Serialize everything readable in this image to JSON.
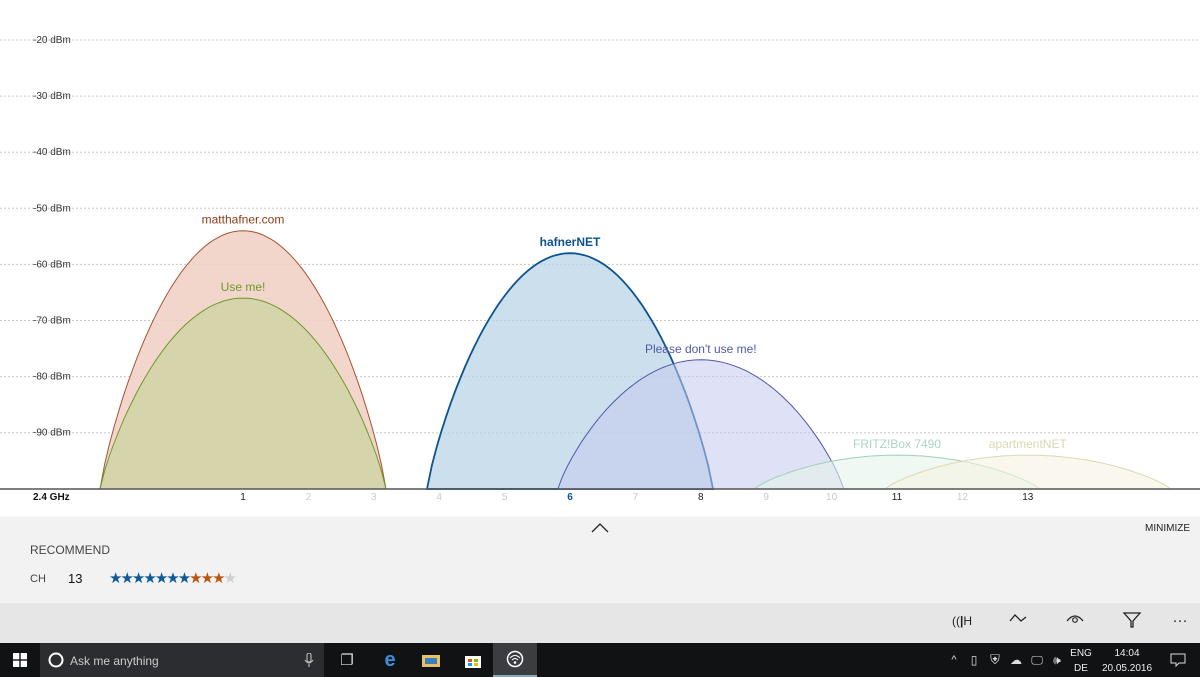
{
  "chart_data": {
    "type": "area",
    "band_label": "2.4 GHz",
    "y_ticks": [
      "-20 dBm",
      "-30 dBm",
      "-40 dBm",
      "-50 dBm",
      "-60 dBm",
      "-70 dBm",
      "-80 dBm",
      "-90 dBm"
    ],
    "y_values": [
      -20,
      -30,
      -40,
      -50,
      -60,
      -70,
      -80,
      -90
    ],
    "ylim": [
      -100,
      -13
    ],
    "channels": [
      "1",
      "2",
      "3",
      "4",
      "5",
      "6",
      "7",
      "8",
      "9",
      "10",
      "11",
      "12",
      "13"
    ],
    "active_channels": [
      1,
      6,
      8,
      11,
      13
    ],
    "highlight_channel": 6,
    "networks": [
      {
        "name": "matthafner.com",
        "channel": 1,
        "signal": -54,
        "stroke": "#a5532f",
        "fill": "#f0cfc3",
        "fill_opacity": 0.85,
        "label_color": "#8a3d1a",
        "bold": false
      },
      {
        "name": "Use me!",
        "channel": 1,
        "signal": -66,
        "stroke": "#6e9a2c",
        "fill": "#cdd3a2",
        "fill_opacity": 0.8,
        "label_color": "#6e9a2c",
        "bold": false
      },
      {
        "name": "hafnerNET",
        "channel": 6,
        "signal": -58,
        "stroke": "#0b5391",
        "fill": "#b6d2e6",
        "fill_opacity": 0.7,
        "label_color": "#0b5391",
        "bold": true
      },
      {
        "name": "Please don't use me!",
        "channel": 8,
        "signal": -77,
        "stroke": "#4f5aa5",
        "fill": "#c4cbef",
        "fill_opacity": 0.55,
        "label_color": "#4f5aa5",
        "bold": false
      },
      {
        "name": "FRITZ!Box 7490",
        "channel": 11,
        "signal": -94,
        "stroke": "#9fd0b8",
        "fill": "#e4f4ea",
        "fill_opacity": 0.6,
        "label_color": "#a9d6bf",
        "bold": false
      },
      {
        "name": "apartmentNET",
        "channel": 13,
        "signal": -94,
        "stroke": "#ddd8b0",
        "fill": "#f6f4e2",
        "fill_opacity": 0.6,
        "label_color": "#ddd6b0",
        "bold": false
      }
    ]
  },
  "panel": {
    "recommend_label": "RECOMMEND",
    "ch_label": "CH",
    "ch_value": "13",
    "rating": {
      "blue": 7,
      "orange": 3,
      "gray": 1,
      "total": 11
    },
    "minimize_label": "MINIMIZE"
  },
  "appbar": {
    "more": "···"
  },
  "taskbar": {
    "search_placeholder": "Ask me anything",
    "lang_top": "ENG",
    "lang_bottom": "DE",
    "time": "14:04",
    "date": "20.05.2016"
  }
}
